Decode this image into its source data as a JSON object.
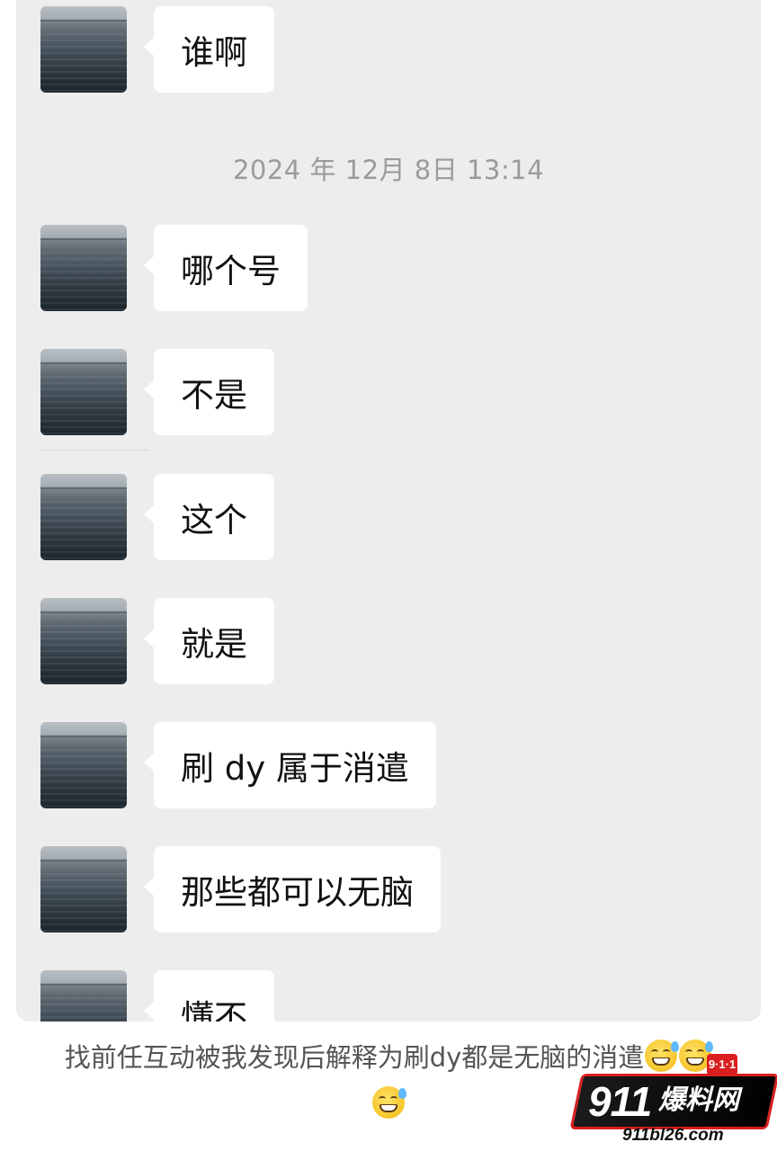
{
  "chat": {
    "timestamp": "2024 年 12月 8日 13:14",
    "messages": [
      {
        "text": "谁啊"
      },
      {
        "text": "哪个号"
      },
      {
        "text": "不是"
      },
      {
        "text": "这个"
      },
      {
        "text": "就是"
      },
      {
        "text": "刷 dy 属于消遣"
      },
      {
        "text": "那些都可以无脑"
      },
      {
        "text": "懂不"
      }
    ]
  },
  "caption": {
    "text": "找前任互动被我发现后解释为刷dy都是无脑的消遣",
    "emoji": "grinning-sweat-emoji"
  },
  "watermark": {
    "digits": "911",
    "name": "爆料网",
    "badge": "9·1·1",
    "url": "911bl26.com"
  },
  "colors": {
    "chat_background": "#ededed",
    "bubble": "#ffffff",
    "timestamp_text": "#9b9b9b",
    "caption_text": "#555555",
    "brand_red": "#d91f1f"
  }
}
